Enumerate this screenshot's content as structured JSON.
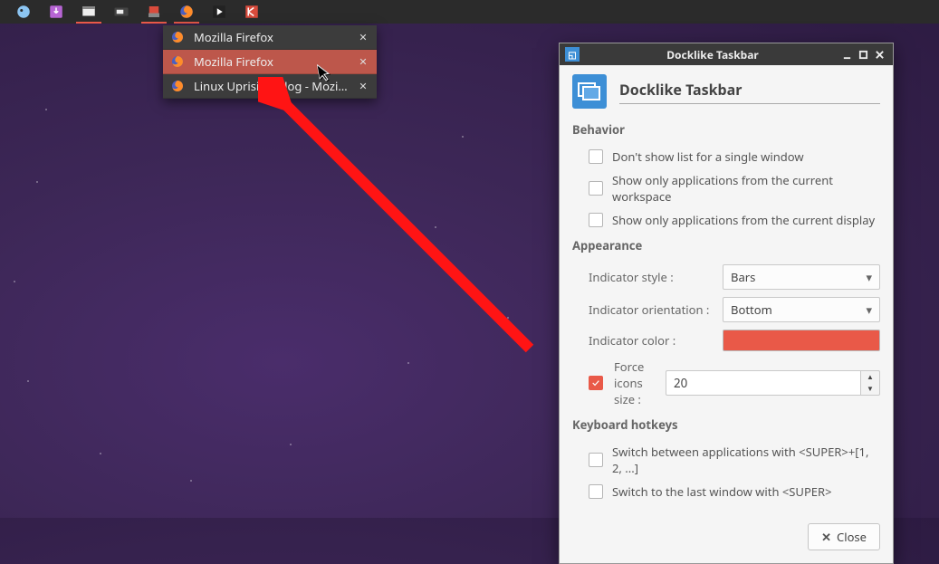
{
  "panel": {
    "icons": [
      {
        "name": "start-menu-icon",
        "running": false
      },
      {
        "name": "download-icon",
        "running": false
      },
      {
        "name": "file-manager-icon",
        "running": true
      },
      {
        "name": "screenshot-icon",
        "running": false
      },
      {
        "name": "transmission-icon",
        "running": true
      },
      {
        "name": "firefox-icon",
        "running": true
      },
      {
        "name": "media-player-icon",
        "running": false
      },
      {
        "name": "kate-icon",
        "running": false
      }
    ]
  },
  "windowList": {
    "items": [
      {
        "label": "Mozilla Firefox",
        "active": false
      },
      {
        "label": "Mozilla Firefox",
        "active": true
      },
      {
        "label": "Linux Uprising Blog - Mozilla Fi...",
        "active": false
      }
    ]
  },
  "dialog": {
    "window_title": "Docklike Taskbar",
    "title": "Docklike Taskbar",
    "behavior": {
      "section": "Behavior",
      "opt1": "Don't show list for a single window",
      "opt2": "Show only applications from the current workspace",
      "opt3": "Show only applications from the current display"
    },
    "appearance": {
      "section": "Appearance",
      "style_label": "Indicator style :",
      "style_value": "Bars",
      "orient_label": "Indicator orientation :",
      "orient_value": "Bottom",
      "color_label": "Indicator color :",
      "color_value": "#e95948",
      "force_label": "Force icons size :",
      "force_value": "20",
      "force_checked": true
    },
    "hotkeys": {
      "section": "Keyboard hotkeys",
      "opt1": "Switch between applications with <SUPER>+[1, 2, ...]",
      "opt2": "Switch to the last window with <SUPER>"
    },
    "close": "Close"
  }
}
